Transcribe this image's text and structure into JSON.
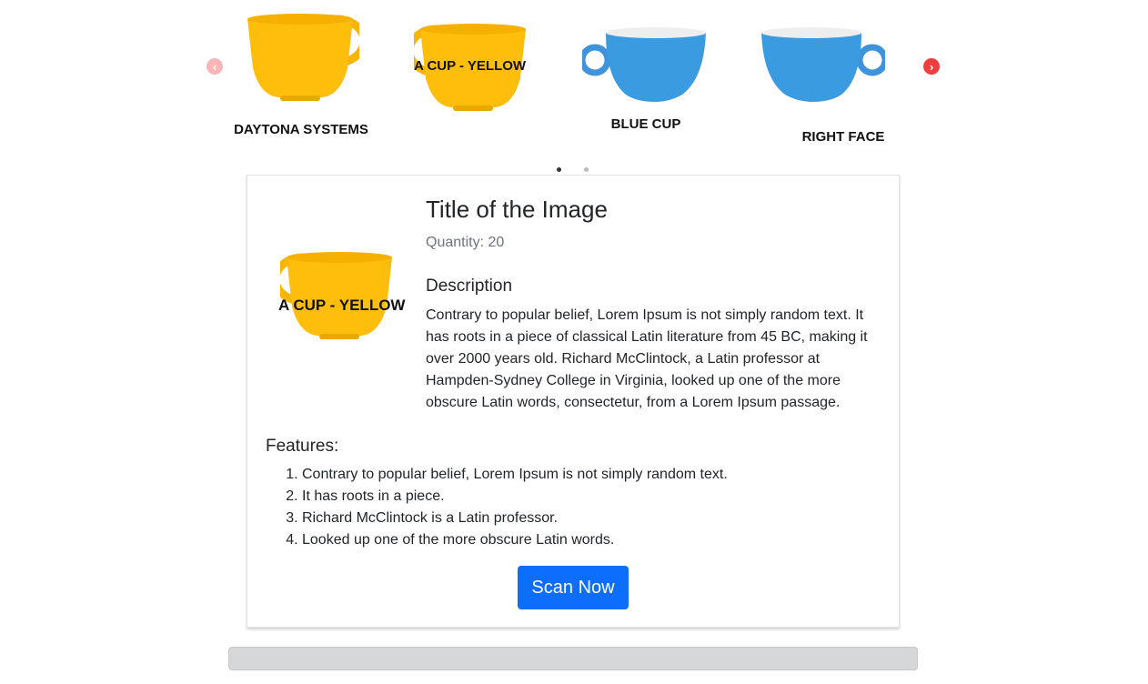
{
  "carousel": {
    "items": [
      {
        "caption": "DAYTONA SYSTEMS",
        "overlay": ""
      },
      {
        "caption": "",
        "overlay": "A CUP - YELLOW"
      },
      {
        "caption": "BLUE CUP",
        "overlay": ""
      },
      {
        "caption": "RIGHT FACE",
        "overlay": ""
      }
    ],
    "prev_icon": "chevron-left-icon",
    "next_icon": "chevron-right-icon",
    "prev_glyph": "‹",
    "next_glyph": "›",
    "active_page": 1,
    "page_count": 2
  },
  "product": {
    "title": "Title of the Image",
    "quantity": "Quantity: 20",
    "image_overlay": "A CUP - YELLOW",
    "description_heading": "Description",
    "description": "Contrary to popular belief, Lorem Ipsum is not simply random text. It has roots in a piece of classical Latin literature from 45 BC, making it over 2000 years old. Richard McClintock, a Latin professor at Hampden-Sydney College in Virginia, looked up one of the more obscure Latin words, consectetur, from a Lorem Ipsum passage.",
    "features_heading": "Features:",
    "features": [
      "Contrary to popular belief, Lorem Ipsum is not simply random text.",
      "It has roots in a piece.",
      "Richard McClintock is a Latin professor.",
      "Looked up one of the more obscure Latin words."
    ],
    "scan_label": "Scan Now"
  },
  "colors": {
    "accent": "#0d6efd",
    "arrow": "#f03e3e",
    "arrow_disabled": "#f9b6b6",
    "yellow": "#ffbf00",
    "blue": "#3b9be0"
  }
}
